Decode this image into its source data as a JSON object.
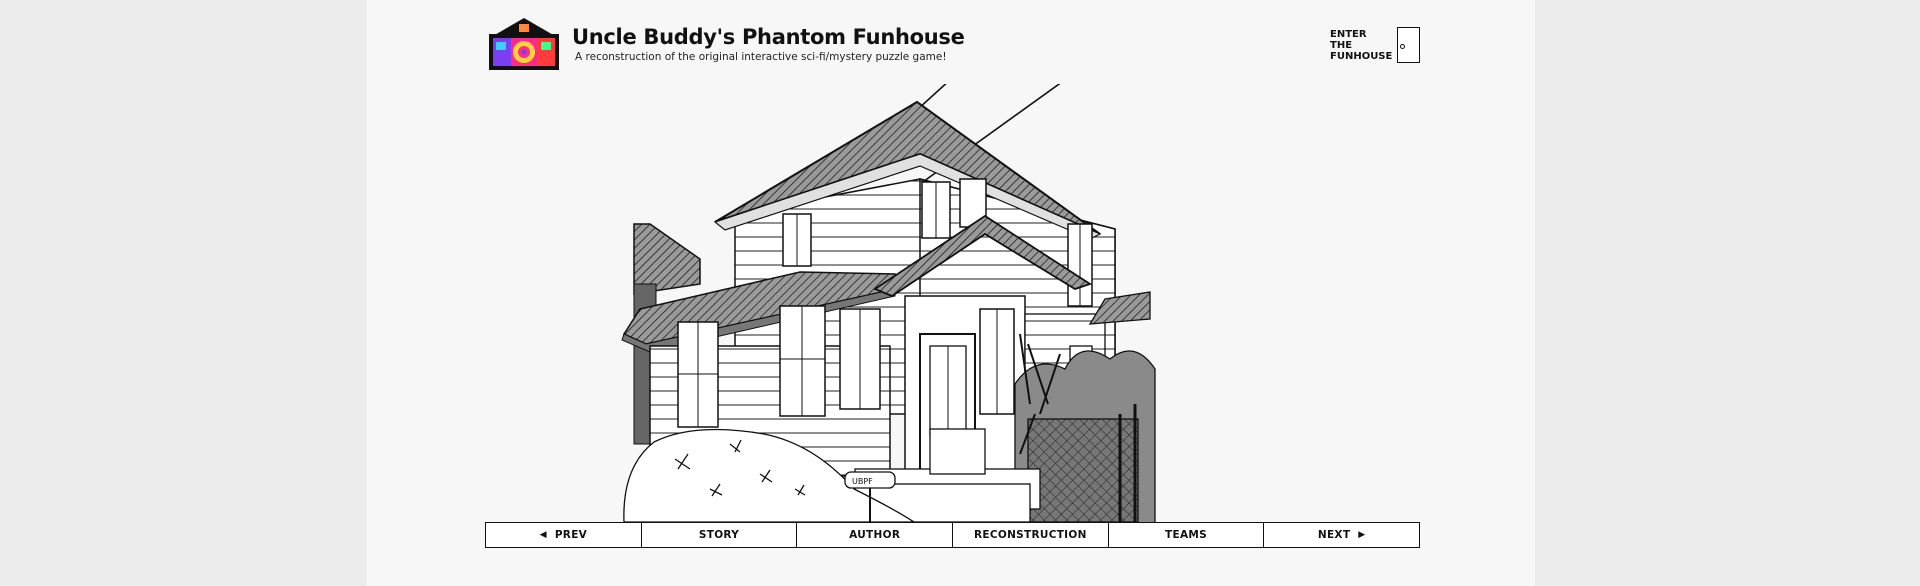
{
  "header": {
    "title": "Uncle Buddy's Phantom Funhouse",
    "subtitle": "A reconstruction of the original interactive sci-fi/mystery puzzle game!",
    "logo_icon": "funhouse-logo-icon",
    "enter_line1": "ENTER THE",
    "enter_line2": "FUNHOUSE",
    "enter_icon": "door-icon"
  },
  "nav": {
    "prev_label": "PREV",
    "prev_icon": "triangle-left-icon",
    "story_label": "STORY",
    "author_label": "AUTHOR",
    "reconstruction_label": "RECONSTRUCTION",
    "teams_label": "TEAMS",
    "next_label": "NEXT",
    "next_icon": "triangle-right-icon"
  },
  "illustration": {
    "subject": "house-illustration",
    "mailbox_text": "UBPF"
  },
  "colors": {
    "page_bg": "#f7f7f7",
    "outer_bg": "#ececec",
    "ink": "#111111",
    "roof_gray": "#666666",
    "shadow_gray": "#8a8a8a"
  }
}
